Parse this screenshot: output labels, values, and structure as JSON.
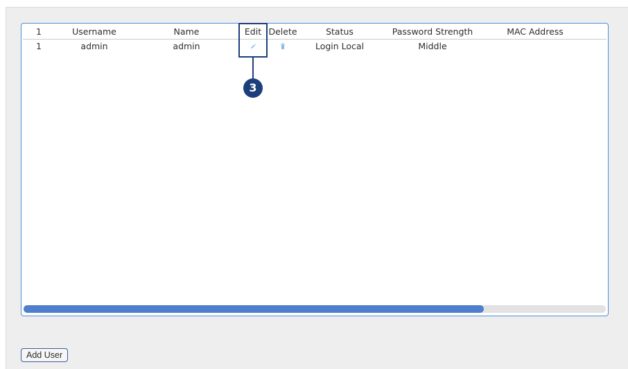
{
  "table": {
    "columns": [
      "1",
      "Username",
      "Name",
      "Edit",
      "Delete",
      "Status",
      "Password Strength",
      "MAC Address"
    ],
    "rows": [
      {
        "index": "1",
        "username": "admin",
        "name": "admin",
        "edit_icon": "pencil-icon",
        "delete_icon": "trash-icon",
        "status": "Login Local",
        "password_strength": "Middle",
        "mac_address": ""
      }
    ],
    "scroll_position_fraction": 0.79
  },
  "callout": {
    "number": "3"
  },
  "buttons": {
    "add_user_label": "Add User"
  },
  "colors": {
    "accent": "#4a90d9",
    "scrollbar_thumb": "#4f7fcc",
    "callout": "#1c3f7c",
    "icon": "#8cb4e8"
  }
}
